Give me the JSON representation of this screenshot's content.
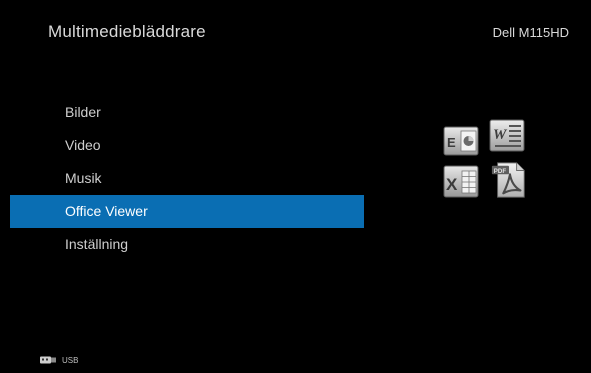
{
  "app": {
    "title": "Multimediebläddrare",
    "model": "Dell M115HD"
  },
  "menu": {
    "items": [
      {
        "label": "Bilder",
        "selected": false
      },
      {
        "label": "Video",
        "selected": false
      },
      {
        "label": "Musik",
        "selected": false
      },
      {
        "label": "Office Viewer",
        "selected": true
      },
      {
        "label": "Inställning",
        "selected": false
      }
    ]
  },
  "preview_icons": {
    "items": [
      {
        "name": "powerpoint-icon",
        "letter": "E"
      },
      {
        "name": "word-icon",
        "letter": "W"
      },
      {
        "name": "excel-icon",
        "letter": "X"
      },
      {
        "name": "pdf-icon",
        "letter": "PDF"
      }
    ]
  },
  "footer": {
    "source_label": "USB"
  },
  "colors": {
    "background": "#000000",
    "selection": "#0a6eb3",
    "text": "#d9d9d9"
  }
}
